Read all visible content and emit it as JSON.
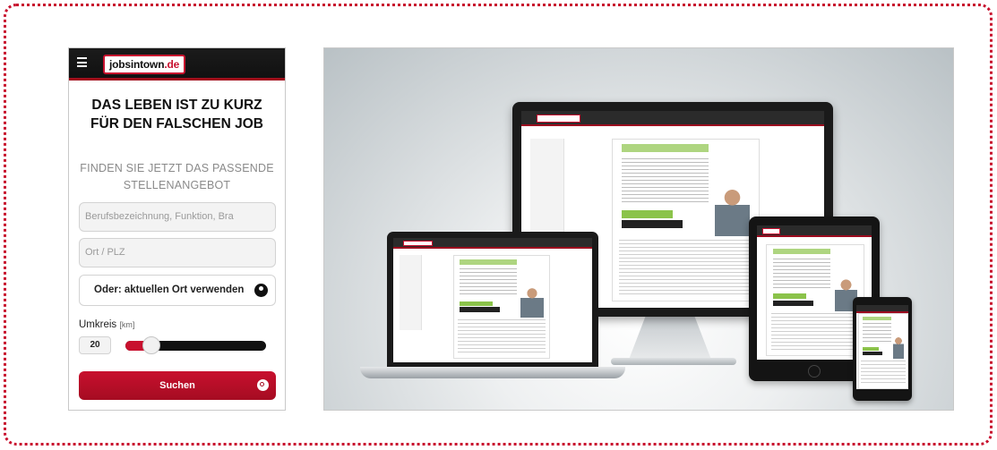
{
  "mobile_form": {
    "logo": {
      "name": "jobsintown",
      "tld": ".de"
    },
    "headline": "DAS LEBEN IST ZU KURZ FÜR DEN FALSCHEN JOB",
    "subline": "FINDEN SIE JETZT DAS PASSENDE STELLENANGEBOT",
    "job_field_placeholder": "Berufsbezeichnung, Funktion, Bra",
    "location_field_placeholder": "Ort / PLZ",
    "geo_button_label": "Oder: aktuellen Ort verwenden",
    "radius_label": "Umkreis",
    "radius_unit": "[km]",
    "radius_value": "20",
    "radius_slider_fraction": 0.12,
    "search_button_label": "Suchen",
    "accent_color": "#c8102e"
  },
  "device_illustration": {
    "devices": [
      "monitor",
      "laptop",
      "tablet",
      "smartphone"
    ]
  },
  "icons": [
    "hamburger-icon",
    "location-pin-icon",
    "search-icon"
  ]
}
